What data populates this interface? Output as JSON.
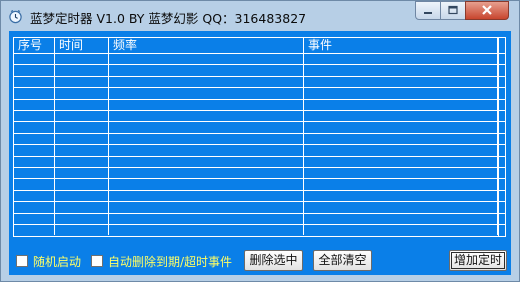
{
  "window": {
    "title": "蓝梦定时器 V1.0 BY 蓝梦幻影 QQ：316483827",
    "app_icon": "clock-icon"
  },
  "grid": {
    "columns": [
      "序号",
      "时间",
      "频率",
      "事件"
    ],
    "rows": [
      [
        "",
        "",
        "",
        ""
      ],
      [
        "",
        "",
        "",
        ""
      ],
      [
        "",
        "",
        "",
        ""
      ],
      [
        "",
        "",
        "",
        ""
      ],
      [
        "",
        "",
        "",
        ""
      ],
      [
        "",
        "",
        "",
        ""
      ],
      [
        "",
        "",
        "",
        ""
      ],
      [
        "",
        "",
        "",
        ""
      ],
      [
        "",
        "",
        "",
        ""
      ],
      [
        "",
        "",
        "",
        ""
      ],
      [
        "",
        "",
        "",
        ""
      ],
      [
        "",
        "",
        "",
        ""
      ],
      [
        "",
        "",
        "",
        ""
      ],
      [
        "",
        "",
        "",
        ""
      ],
      [
        "",
        "",
        "",
        ""
      ],
      [
        "",
        "",
        "",
        ""
      ]
    ]
  },
  "options": {
    "autostart_label": "随机启动",
    "autostart_checked": false,
    "autodelete_label": "自动删除到期/超时事件",
    "autodelete_checked": false
  },
  "buttons": {
    "delete_selected": "删除选中",
    "clear_all": "全部清空",
    "add_timer": "增加定时"
  },
  "colors": {
    "client_bg": "#0a7fe8",
    "label_text": "#ffff66",
    "grid_lines": "#ffffff"
  }
}
